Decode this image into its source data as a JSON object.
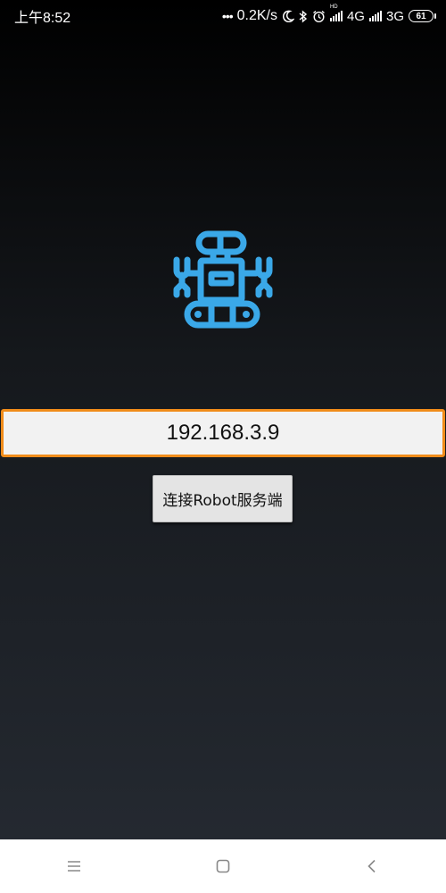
{
  "status_bar": {
    "time": "上午8:52",
    "dots": "•••",
    "network_speed": "0.2K/s",
    "hd_label": "HD",
    "net1": "4G",
    "net2": "3G",
    "battery": "61"
  },
  "main": {
    "ip_value": "192.168.3.9",
    "connect_button_label": "连接Robot服务端",
    "logo_icon": "robot-icon",
    "logo_color": "#3aa8e8",
    "input_border_color": "#f08c1a"
  },
  "nav_bar": {
    "items": [
      {
        "icon": "menu-icon"
      },
      {
        "icon": "home-square-icon"
      },
      {
        "icon": "back-icon"
      }
    ]
  }
}
